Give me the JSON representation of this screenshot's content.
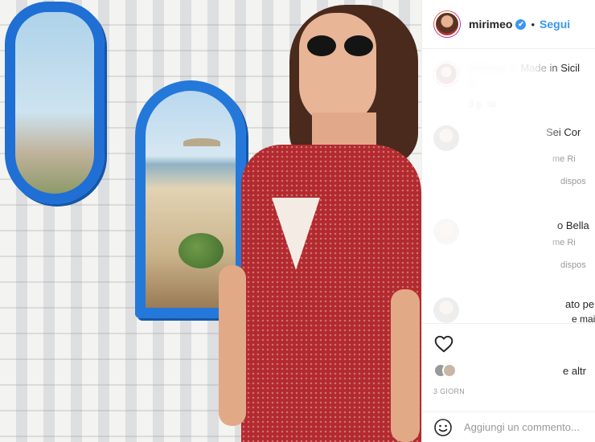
{
  "post": {
    "username": "mirimeo",
    "verified_mark": "✔",
    "separator": "•",
    "follow_label": "Segui"
  },
  "comments": [
    {
      "visible_text": "Made in Sicil",
      "meta": "",
      "reply": ""
    },
    {
      "visible_text": "Sei Cor",
      "meta": "me   Ri",
      "reply": "dispos"
    },
    {
      "visible_text": "o Bella",
      "meta": "me   Ri",
      "reply": "dispos"
    },
    {
      "visible_text": "ato per",
      "meta": "e mai.",
      "reply": ""
    }
  ],
  "likes": {
    "text": "e altr"
  },
  "date": "3 GIORN",
  "comment_input": {
    "placeholder": "Aggiungi un commento..."
  },
  "icons": {
    "like": "heart-icon",
    "emoji": "emoji-icon",
    "verified": "verified-badge-icon"
  },
  "colors": {
    "link_blue": "#3897f0",
    "mirror_blue": "#1f6fd4",
    "dress_red": "#b32a2e"
  }
}
